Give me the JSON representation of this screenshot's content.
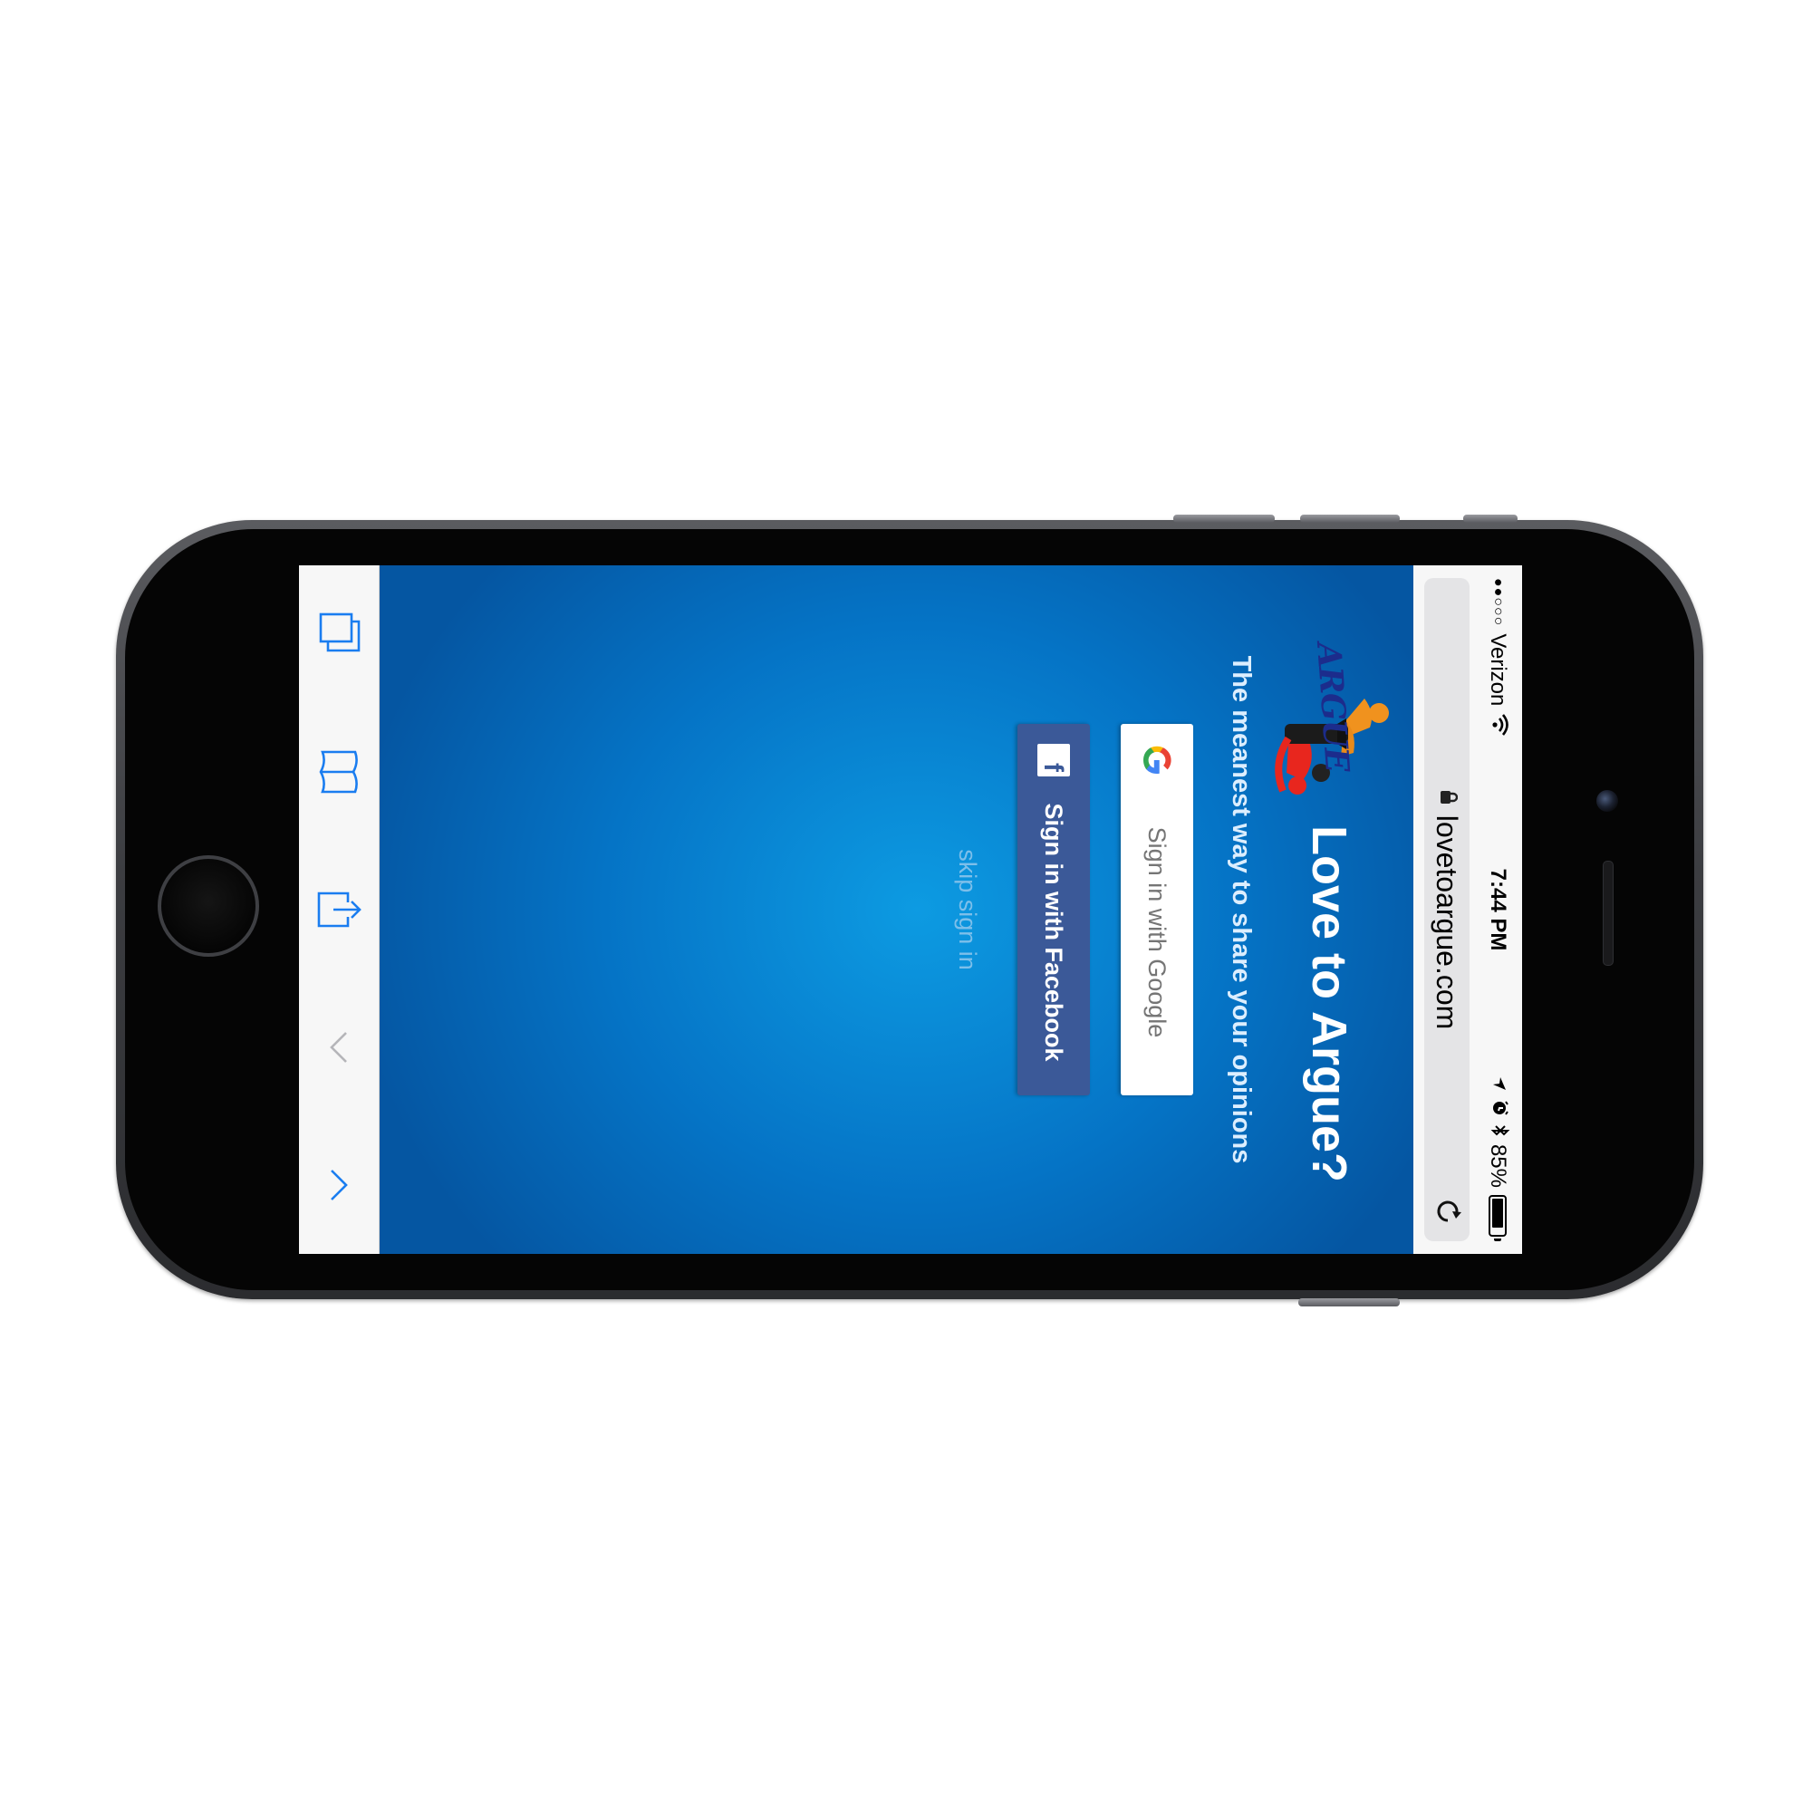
{
  "status_bar": {
    "signal": "●●○○○",
    "carrier": "Verizon",
    "time": "7:44 PM",
    "battery_percent": "85%",
    "battery_level": 0.85
  },
  "browser": {
    "url": "lovetoargue.com"
  },
  "page": {
    "logo_text": "ARGUE",
    "title": "Love to Argue?",
    "tagline": "The meanest way to share your opinions",
    "google_button": "Sign in with Google",
    "google_icon_letter": "G",
    "facebook_button": "Sign in with Facebook",
    "facebook_icon_letter": "f",
    "skip_link": "skip sign in"
  },
  "toolbar": {
    "icons": [
      "chevron-up-icon",
      "chevron-down-icon",
      "share-icon",
      "bookmarks-icon",
      "tabs-icon"
    ]
  },
  "colors": {
    "accent": "#1a7df0",
    "background": "#0a76c8",
    "facebook": "#3b5998",
    "google_button": "#ffffff",
    "logo_orange": "#f0921e",
    "logo_red": "#e8261e"
  }
}
